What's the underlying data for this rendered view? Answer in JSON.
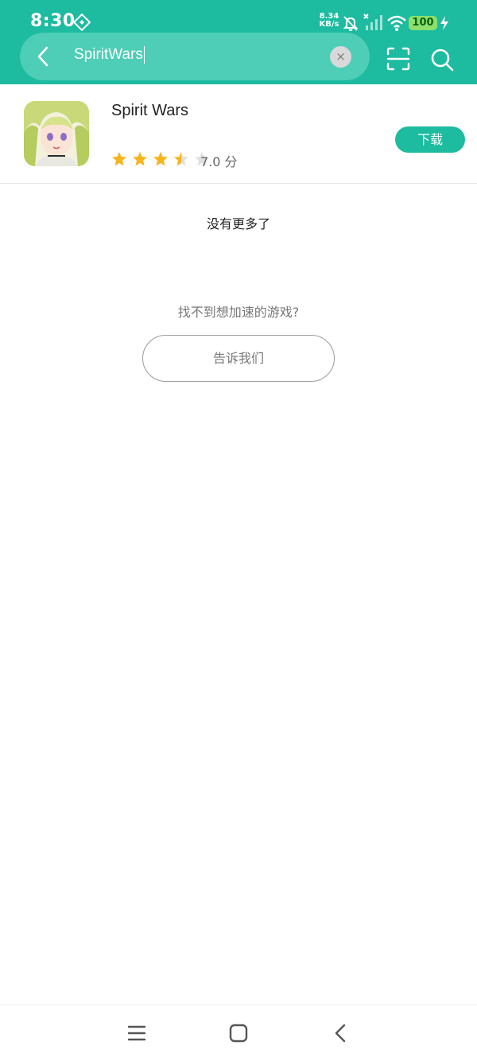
{
  "status_bar": {
    "time": "8:30",
    "net_speed_value": "8.34",
    "net_speed_unit": "KB/s",
    "battery": "100",
    "icons": [
      "vpn-icon",
      "mute-icon",
      "signal-icon",
      "wifi-icon",
      "charging-icon"
    ]
  },
  "search": {
    "query": "SpiritWars",
    "clear_icon": "×",
    "icons": [
      "back-icon",
      "scan-icon",
      "search-icon"
    ]
  },
  "result": {
    "app_name": "Spirit Wars",
    "rating_text": "7.0 分",
    "stars_filled": 3.5,
    "stars_total": 5,
    "download_label": "下载"
  },
  "messages": {
    "no_more": "没有更多了",
    "cant_find": "找不到想加速的游戏?",
    "tell_us": "告诉我们"
  },
  "nav": {
    "icons": [
      "menu-icon",
      "home-icon",
      "back-nav-icon"
    ]
  },
  "colors": {
    "accent": "#1dbb9f",
    "star": "#f7b51c",
    "star_empty": "#e0e0e0"
  }
}
